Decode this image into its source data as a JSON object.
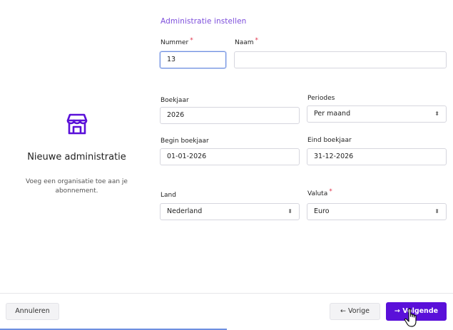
{
  "left": {
    "title": "Nieuwe administratie",
    "subtitle": "Voeg een organisatie toe aan je abonnement.",
    "icon": "store-icon",
    "accent": "#5a10d9"
  },
  "form": {
    "section_title": "Administratie instellen",
    "nummer": {
      "label": "Nummer",
      "value": "13"
    },
    "naam": {
      "label": "Naam",
      "value": ""
    },
    "boekjaar": {
      "label": "Boekjaar",
      "value": "2026"
    },
    "periodes": {
      "label": "Periodes",
      "value": "Per maand"
    },
    "begin_boekjaar": {
      "label": "Begin boekjaar",
      "value": "01-01-2026"
    },
    "eind_boekjaar": {
      "label": "Eind boekjaar",
      "value": "31-12-2026"
    },
    "land": {
      "label": "Land",
      "value": "Nederland"
    },
    "valuta": {
      "label": "Valuta",
      "value": "Euro"
    }
  },
  "footer": {
    "cancel_label": "Annuleren",
    "prev_label": "Vorige",
    "next_label": "Volgende"
  }
}
